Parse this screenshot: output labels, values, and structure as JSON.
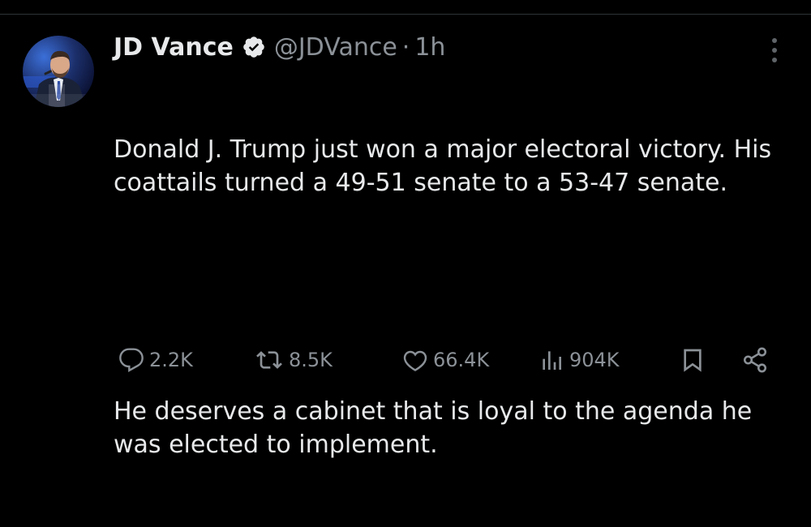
{
  "tweet": {
    "author": {
      "name": "JD Vance",
      "handle": "@JDVance",
      "separator": "·",
      "time": "1h"
    },
    "text": {
      "paragraph1": "Donald J. Trump just won a major electoral victory. His coattails turned a 49-51 senate to a 53-47 senate.",
      "paragraph2": "He deserves a cabinet that is loyal to the agenda he was elected to implement."
    },
    "actions": {
      "replies": "2.2K",
      "reposts": "8.5K",
      "likes": "66.4K",
      "views": "904K"
    }
  },
  "icons": {
    "verified": "verified-badge-icon",
    "more": "more-vertical-icon",
    "reply": "reply-icon",
    "repost": "repost-icon",
    "like": "heart-icon",
    "views": "views-chart-icon",
    "bookmark": "bookmark-icon",
    "share": "share-icon"
  },
  "colors": {
    "background": "#000000",
    "text": "#e7e9ea",
    "muted": "#8b9197",
    "verified_badge": "#e7e9ea"
  }
}
